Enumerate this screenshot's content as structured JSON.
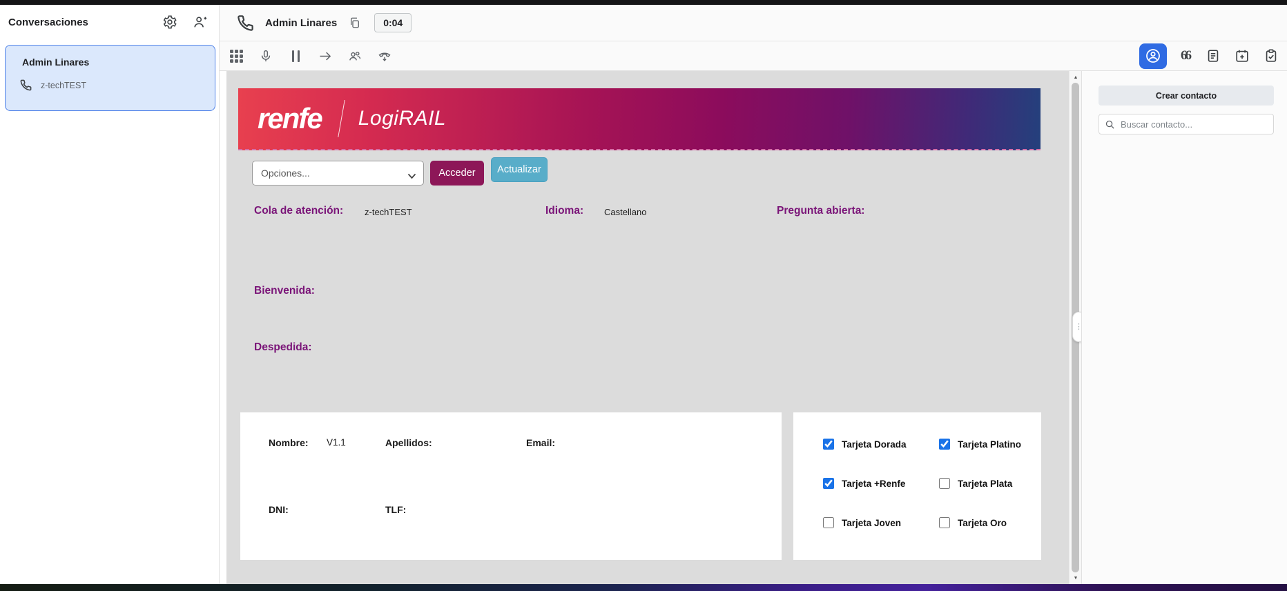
{
  "window": {
    "icons": {
      "chevron_left": "❮",
      "plus": "+",
      "quote": "66",
      "scroll_up": "▲",
      "scroll_down": "▼",
      "drag_dots": "⋮"
    }
  },
  "sidebar": {
    "title": "Conversaciones",
    "conversation": {
      "name": "Admin Linares",
      "queue": "z-techTEST"
    }
  },
  "callbar": {
    "caller": "Admin Linares",
    "timer": "0:04"
  },
  "contact_panel": {
    "create_button": "Crear contacto",
    "search_placeholder": "Buscar contacto..."
  },
  "page": {
    "brand": "renfe",
    "brand_product": "LogiRAIL",
    "options_select": "Opciones...",
    "access_button": "Acceder",
    "update_button": "Actualizar",
    "queue_label": "Cola de atención:",
    "queue_value": "z-techTEST",
    "language_label": "Idioma:",
    "language_value": "Castellano",
    "open_question_label": "Pregunta abierta:",
    "welcome_label": "Bienvenida:",
    "farewell_label": "Despedida:",
    "form": {
      "name_label": "Nombre:",
      "name_value": "V1.1",
      "surname_label": "Apellidos:",
      "email_label": "Email:",
      "dni_label": "DNI:",
      "tlf_label": "TLF:"
    },
    "cards": [
      {
        "label": "Tarjeta Dorada",
        "checked": true
      },
      {
        "label": "Tarjeta Platino",
        "checked": true
      },
      {
        "label": "Tarjeta +Renfe",
        "checked": true
      },
      {
        "label": "Tarjeta Plata",
        "checked": false
      },
      {
        "label": "Tarjeta Joven",
        "checked": false
      },
      {
        "label": "Tarjeta Oro",
        "checked": false
      }
    ]
  },
  "colors": {
    "accent_purple": "#7a1478",
    "acceder_bg": "#8d1758",
    "actualizar_bg": "#58adc9",
    "active_tool_bg": "#2f6be3",
    "checkbox_blue": "#1a73e8",
    "conversation_bg": "#dbe8fc",
    "conversation_border": "#4f82e8",
    "banner_gradient": [
      "#e8404f",
      "#a51355",
      "#8c0c5c",
      "#24407c"
    ]
  }
}
